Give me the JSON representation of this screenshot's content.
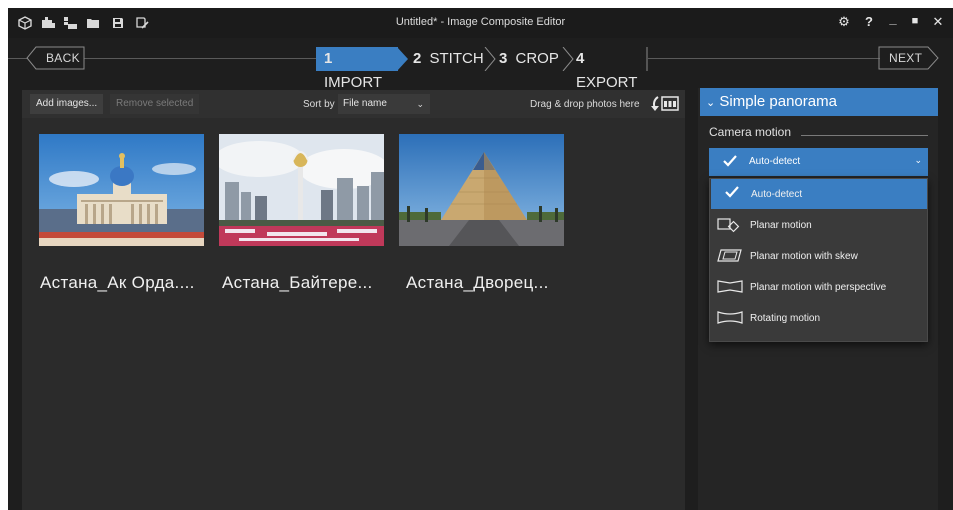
{
  "window": {
    "title": "Untitled* - Image Composite Editor",
    "toolbar_icons": [
      "new-project-icon",
      "add-images-icon",
      "add-image-sequence-icon",
      "open-folder-icon",
      "save-icon",
      "save-as-icon"
    ],
    "controls": {
      "settings_glyph": "⚙",
      "help_glyph": "?",
      "minimize_glyph": "_",
      "maximize_glyph": "■",
      "close_glyph": "✕"
    }
  },
  "steps": {
    "back_label": "BACK",
    "next_label": "NEXT",
    "items": [
      {
        "number": "1",
        "label": "IMPORT",
        "active": true
      },
      {
        "number": "2",
        "label": "STITCH",
        "active": false
      },
      {
        "number": "3",
        "label": "CROP",
        "active": false
      },
      {
        "number": "4",
        "label": "EXPORT",
        "active": false
      }
    ]
  },
  "import_panel": {
    "add_images_label": "Add images...",
    "remove_selected_label": "Remove selected",
    "sort_by_label": "Sort by",
    "sort_value": "File name",
    "drag_drop_label": "Drag & drop photos here",
    "images": [
      {
        "label": "Астана_Ак Орда...."
      },
      {
        "label": "Астана_Байтере..."
      },
      {
        "label": "Астана_Дворец..."
      }
    ]
  },
  "right_panel": {
    "panorama_header": "Simple panorama",
    "camera_motion_label": "Camera motion",
    "selected_option": "Auto-detect",
    "options": [
      {
        "label": "Auto-detect",
        "icon": "checkmark-icon",
        "selected": true
      },
      {
        "label": "Planar motion",
        "icon": "planar-motion-icon",
        "selected": false
      },
      {
        "label": "Planar motion with skew",
        "icon": "planar-skew-icon",
        "selected": false
      },
      {
        "label": "Planar motion with perspective",
        "icon": "planar-perspective-icon",
        "selected": false
      },
      {
        "label": "Rotating motion",
        "icon": "rotating-motion-icon",
        "selected": false
      }
    ]
  },
  "colors": {
    "accent": "#3a7ec2",
    "window_bg": "#1e1e1e",
    "panel_bg": "#2b2b2b"
  }
}
